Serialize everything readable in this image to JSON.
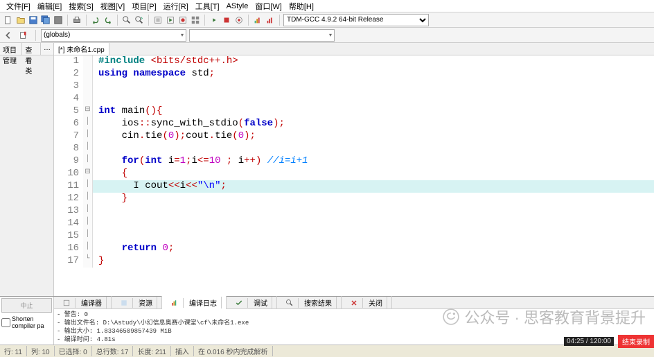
{
  "menubar": [
    "文件[F]",
    "编辑[E]",
    "搜索[S]",
    "视图[V]",
    "项目[P]",
    "运行[R]",
    "工具[T]",
    "AStyle",
    "窗口[W]",
    "帮助[H]"
  ],
  "toolbar_compiler": "TDM-GCC 4.9.2 64-bit Release",
  "row2": {
    "globals": "(globals)"
  },
  "sidebar_tabs": [
    "项目管理",
    "查看类",
    "…"
  ],
  "editor_tab": "[*] 未命名1.cpp",
  "code": [
    {
      "n": 1,
      "f": "",
      "h": [
        [
          "pp",
          "#include"
        ],
        [
          "",
          " "
        ],
        [
          "pn",
          "<bits/stdc++.h>"
        ]
      ]
    },
    {
      "n": 2,
      "f": "",
      "h": [
        [
          "kw",
          "using"
        ],
        [
          "",
          " "
        ],
        [
          "kw",
          "namespace"
        ],
        [
          "",
          " std"
        ],
        [
          "pn",
          ";"
        ]
      ]
    },
    {
      "n": 3,
      "f": "",
      "h": [
        [
          "",
          ""
        ]
      ]
    },
    {
      "n": 4,
      "f": "",
      "h": [
        [
          "",
          ""
        ]
      ]
    },
    {
      "n": 5,
      "f": "⊟",
      "h": [
        [
          "kw",
          "int"
        ],
        [
          "",
          " main"
        ],
        [
          "pn",
          "(){"
        ]
      ]
    },
    {
      "n": 6,
      "f": "│",
      "h": [
        [
          "",
          "    ios"
        ],
        [
          "pn",
          "::"
        ],
        [
          "",
          "sync_with_stdio"
        ],
        [
          "pn",
          "("
        ],
        [
          "kw",
          "false"
        ],
        [
          "pn",
          ");"
        ]
      ]
    },
    {
      "n": 7,
      "f": "│",
      "h": [
        [
          "",
          "    cin"
        ],
        [
          "pn",
          "."
        ],
        [
          "",
          "tie"
        ],
        [
          "pn",
          "("
        ],
        [
          "num",
          "0"
        ],
        [
          "pn",
          ");"
        ],
        [
          "",
          "cout"
        ],
        [
          "pn",
          "."
        ],
        [
          "",
          "tie"
        ],
        [
          "pn",
          "("
        ],
        [
          "num",
          "0"
        ],
        [
          "pn",
          ");"
        ]
      ]
    },
    {
      "n": 8,
      "f": "│",
      "h": [
        [
          "",
          ""
        ]
      ]
    },
    {
      "n": 9,
      "f": "│",
      "h": [
        [
          "",
          "    "
        ],
        [
          "kw",
          "for"
        ],
        [
          "pn",
          "("
        ],
        [
          "kw",
          "int"
        ],
        [
          "",
          " i"
        ],
        [
          "pn",
          "="
        ],
        [
          "num",
          "1"
        ],
        [
          "pn",
          ";"
        ],
        [
          "",
          "i"
        ],
        [
          "pn",
          "<="
        ],
        [
          "num",
          "10"
        ],
        [
          "",
          " "
        ],
        [
          "pn",
          ";"
        ],
        [
          "",
          " i"
        ],
        [
          "pn",
          "++)"
        ],
        [
          "",
          " "
        ],
        [
          "cmt",
          "//i=i+1"
        ]
      ]
    },
    {
      "n": 10,
      "f": "⊟",
      "h": [
        [
          "",
          "    "
        ],
        [
          "pn",
          "{"
        ]
      ]
    },
    {
      "n": 11,
      "f": "│",
      "hl": true,
      "h": [
        [
          "",
          "      "
        ],
        [
          "",
          "I "
        ],
        [
          "",
          "cout"
        ],
        [
          "pn",
          "<<"
        ],
        [
          "",
          "i"
        ],
        [
          "pn",
          "<<"
        ],
        [
          "str",
          "\"\\n\""
        ],
        [
          "pn",
          ";"
        ]
      ]
    },
    {
      "n": 12,
      "f": "│",
      "h": [
        [
          "",
          "    "
        ],
        [
          "pn",
          "}"
        ]
      ]
    },
    {
      "n": 13,
      "f": "│",
      "h": [
        [
          "",
          ""
        ]
      ]
    },
    {
      "n": 14,
      "f": "│",
      "h": [
        [
          "",
          ""
        ]
      ]
    },
    {
      "n": 15,
      "f": "│",
      "h": [
        [
          "",
          ""
        ]
      ]
    },
    {
      "n": 16,
      "f": "│",
      "h": [
        [
          "",
          "    "
        ],
        [
          "kw",
          "return"
        ],
        [
          "",
          " "
        ],
        [
          "num",
          "0"
        ],
        [
          "pn",
          ";"
        ]
      ]
    },
    {
      "n": 17,
      "f": "└",
      "h": [
        [
          "pn",
          "}"
        ]
      ]
    }
  ],
  "bottom": {
    "left_btn": "中止",
    "left_check": "Shorten compiler pa",
    "tabs": [
      "编译器",
      "资源",
      "编译日志",
      "调试",
      "搜索结果",
      "关闭"
    ],
    "active_tab": 2,
    "tab_icons": [
      "compiler-icon",
      "resource-icon",
      "log-icon",
      "debug-icon",
      "search-icon",
      "close-icon"
    ],
    "out": [
      "- 警告: 0",
      "- 输出文件名: D:\\Astudy\\小幻信息奥赛小课堂\\cf\\未命名1.exe",
      "- 输出大小: 1.83346509857439 MiB",
      "- 编译时间: 4.81s"
    ]
  },
  "status": {
    "line": "行: 11",
    "col": "列: 10",
    "sel": "已选择: 0",
    "total": "总行数: 17",
    "len": "长度: 211",
    "ins": "插入",
    "msg": "在 0.016 秒内完成解析"
  },
  "watermark": "公众号 · 思客教育背景提升",
  "rec": {
    "time": "04:25 / 120:00",
    "label": "结束录制"
  }
}
